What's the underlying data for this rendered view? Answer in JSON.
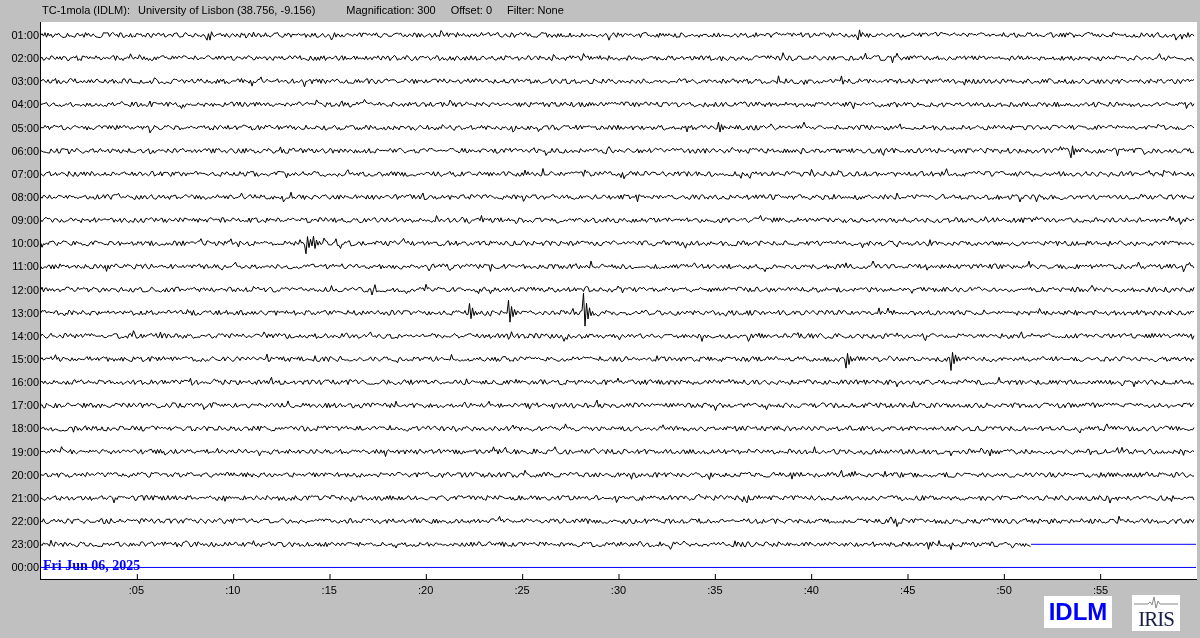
{
  "header": {
    "station": "TC-1mola (IDLM):",
    "location": "University of Lisbon (38.756, -9.156)",
    "magnification": "Magnification: 300",
    "offset": "Offset: 0",
    "filter": "Filter: None"
  },
  "helicorder": {
    "rows": [
      {
        "time": "01:00",
        "kind": "trace"
      },
      {
        "time": "02:00",
        "kind": "trace"
      },
      {
        "time": "03:00",
        "kind": "trace"
      },
      {
        "time": "04:00",
        "kind": "trace"
      },
      {
        "time": "05:00",
        "kind": "trace"
      },
      {
        "time": "06:00",
        "kind": "trace"
      },
      {
        "time": "07:00",
        "kind": "trace"
      },
      {
        "time": "08:00",
        "kind": "trace"
      },
      {
        "time": "09:00",
        "kind": "trace"
      },
      {
        "time": "10:00",
        "kind": "trace"
      },
      {
        "time": "11:00",
        "kind": "trace"
      },
      {
        "time": "12:00",
        "kind": "trace"
      },
      {
        "time": "13:00",
        "kind": "trace"
      },
      {
        "time": "14:00",
        "kind": "trace"
      },
      {
        "time": "15:00",
        "kind": "trace"
      },
      {
        "time": "16:00",
        "kind": "trace"
      },
      {
        "time": "17:00",
        "kind": "trace"
      },
      {
        "time": "18:00",
        "kind": "trace"
      },
      {
        "time": "19:00",
        "kind": "trace"
      },
      {
        "time": "20:00",
        "kind": "trace"
      },
      {
        "time": "21:00",
        "kind": "trace"
      },
      {
        "time": "22:00",
        "kind": "trace"
      },
      {
        "time": "23:00",
        "kind": "partial"
      },
      {
        "time": "00:00",
        "kind": "empty"
      }
    ],
    "date": "Fri Jun 06, 2025",
    "x_ticks": [
      ":05",
      ":10",
      ":15",
      ":20",
      ":25",
      ":30",
      ":35",
      ":40",
      ":45",
      ":50",
      ":55"
    ]
  },
  "logos": {
    "station": "IDLM",
    "network": "IRIS"
  }
}
